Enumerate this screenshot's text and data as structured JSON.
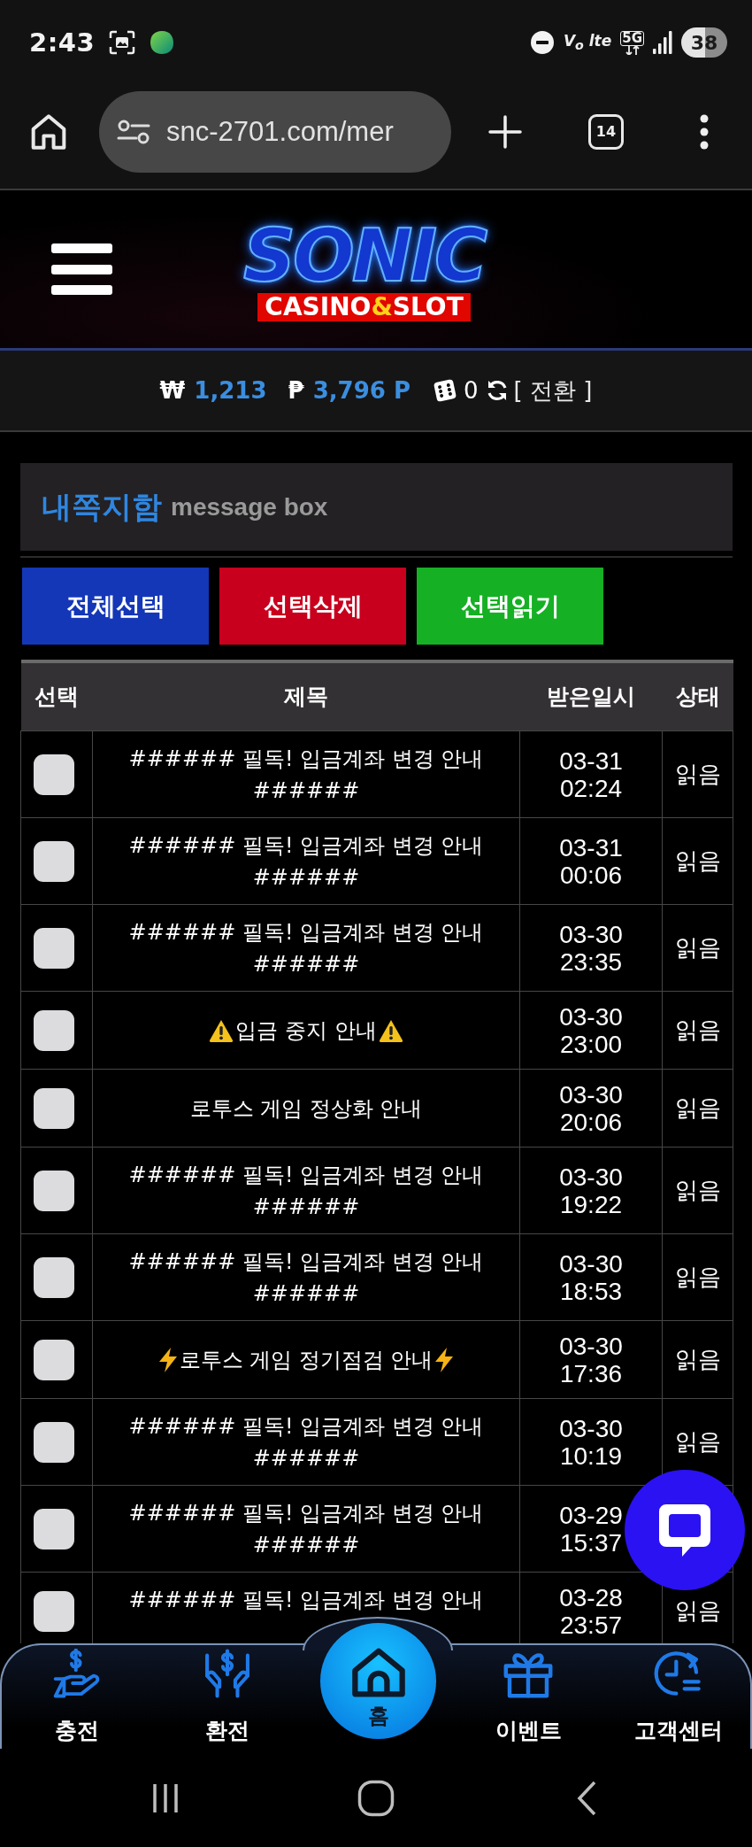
{
  "status_bar": {
    "time": "2:43",
    "volte": "V$_{o}$ lte",
    "network": "5G",
    "battery": "38"
  },
  "browser": {
    "url": "snc-2701.com/mer",
    "tab_count": "14"
  },
  "site_header": {
    "logo_title": "SONIC",
    "logo_subtitle": [
      "CASINO",
      "&",
      "SLOT"
    ]
  },
  "balance": {
    "won_sign": "₩",
    "cash": "1,213",
    "point_sign": "₱",
    "points": "3,796 P",
    "chips": "0",
    "convert": "[ 전환 ]"
  },
  "message_box": {
    "title": "내쪽지함",
    "subtitle": "message box"
  },
  "actions": [
    {
      "label": "전체선택",
      "color": "#1437b8"
    },
    {
      "label": "선택삭제",
      "color": "#c8001e"
    },
    {
      "label": "선택읽기",
      "color": "#16b024"
    }
  ],
  "table": {
    "columns": [
      "선택",
      "제목",
      "받은일시",
      "상태"
    ],
    "rows": [
      {
        "checked": false,
        "kind": "plain",
        "title": "###### 필독! 입금계좌 변경 안내 ######",
        "date": "03-31",
        "time": "02:24",
        "status": "읽음"
      },
      {
        "checked": false,
        "kind": "plain",
        "title": "###### 필독! 입금계좌 변경 안내 ######",
        "date": "03-31",
        "time": "00:06",
        "status": "읽음"
      },
      {
        "checked": false,
        "kind": "plain",
        "title": "###### 필독! 입금계좌 변경 안내 ######",
        "date": "03-30",
        "time": "23:35",
        "status": "읽음"
      },
      {
        "checked": false,
        "kind": "warning",
        "title": "입금 중지 안내",
        "date": "03-30",
        "time": "23:00",
        "status": "읽음"
      },
      {
        "checked": false,
        "kind": "plain",
        "title": "로투스 게임 정상화 안내",
        "date": "03-30",
        "time": "20:06",
        "status": "읽음"
      },
      {
        "checked": false,
        "kind": "plain",
        "title": "###### 필독! 입금계좌 변경 안내 ######",
        "date": "03-30",
        "time": "19:22",
        "status": "읽음"
      },
      {
        "checked": false,
        "kind": "plain",
        "title": "###### 필독! 입금계좌 변경 안내 ######",
        "date": "03-30",
        "time": "18:53",
        "status": "읽음"
      },
      {
        "checked": false,
        "kind": "bolt",
        "title": "로투스 게임 정기점검 안내",
        "date": "03-30",
        "time": "17:36",
        "status": "읽음"
      },
      {
        "checked": false,
        "kind": "plain",
        "title": "###### 필독! 입금계좌 변경 안내 ######",
        "date": "03-30",
        "time": "10:19",
        "status": "읽음"
      },
      {
        "checked": false,
        "kind": "plain",
        "title": "###### 필독! 입금계좌 변경 안내 ######",
        "date": "03-29",
        "time": "15:37"
      },
      {
        "checked": false,
        "kind": "plain",
        "title": "###### 필독! 입금계좌 변경 안내",
        "date": "03-28",
        "time": "23:57",
        "status": "읽음"
      }
    ]
  },
  "bottom_nav": [
    {
      "label": "충전",
      "kind": "charge"
    },
    {
      "label": "환전",
      "kind": "exchange"
    },
    {
      "label": "홈",
      "kind": "home"
    },
    {
      "label": "이벤트",
      "kind": "event"
    },
    {
      "label": "고객센터",
      "kind": "support"
    }
  ]
}
